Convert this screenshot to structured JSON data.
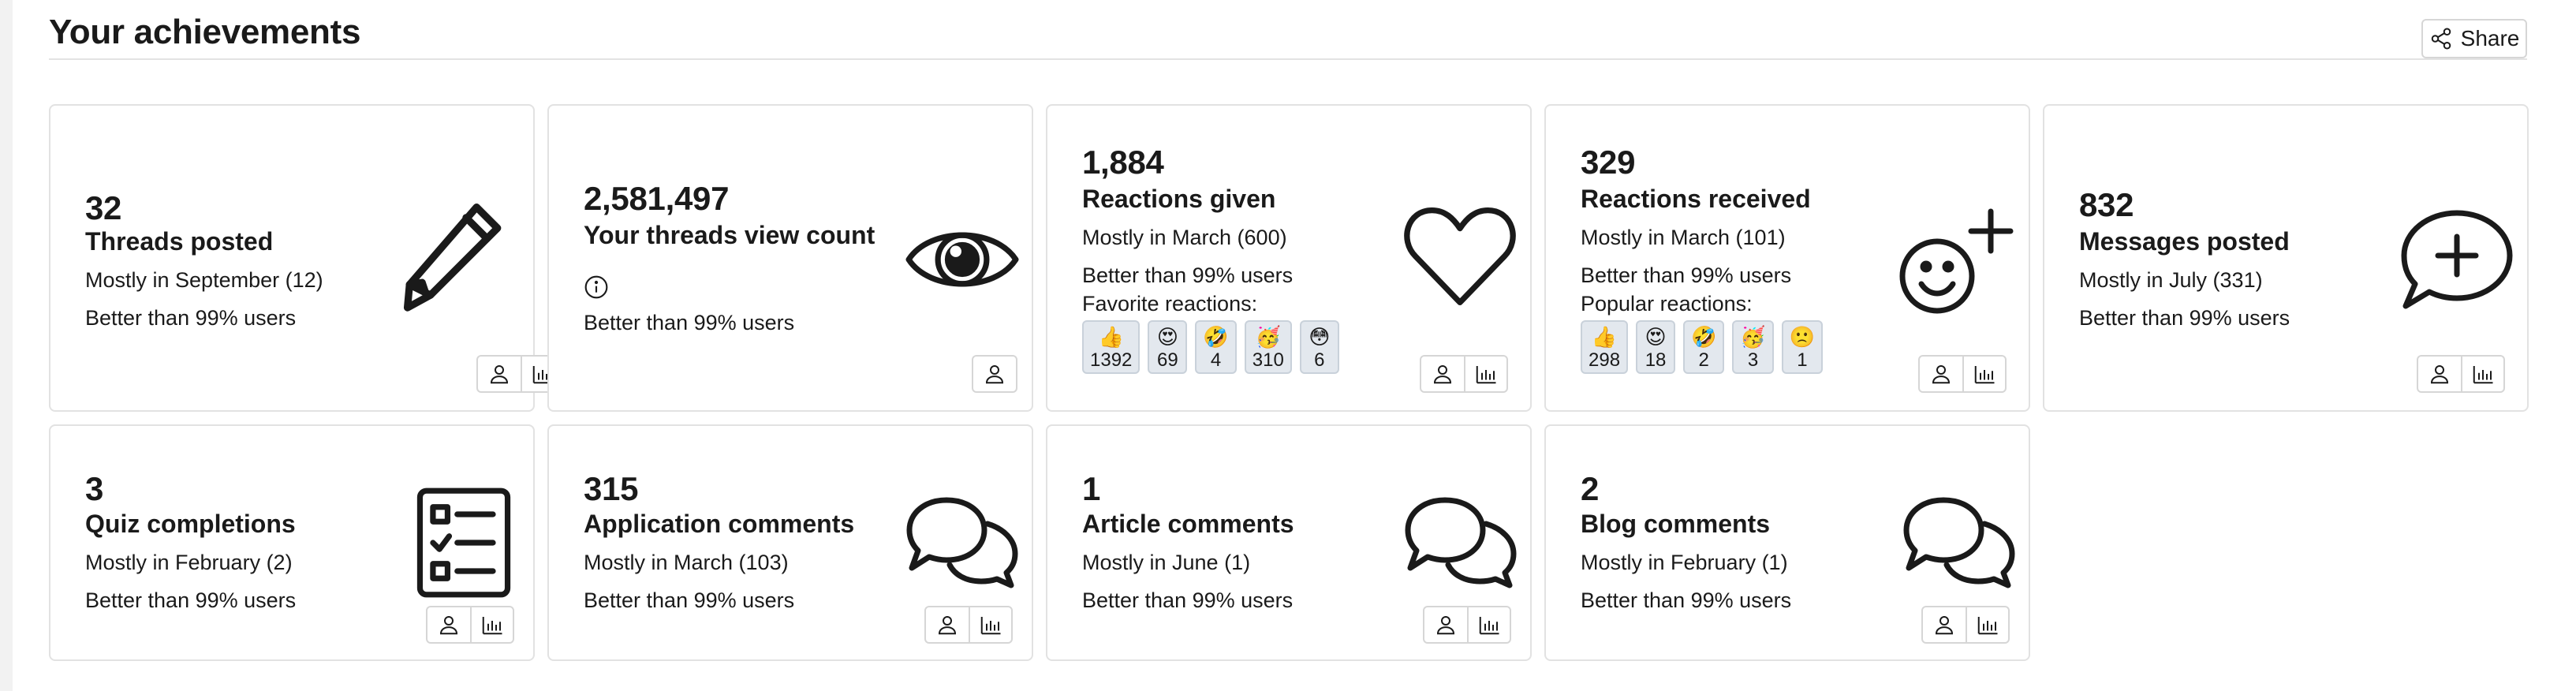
{
  "page": {
    "title": "Your achievements",
    "share_label": "Share"
  },
  "cards": {
    "threads": {
      "value": "32",
      "label": "Threads posted",
      "line1": "Mostly in September (12)",
      "line2": "Better than 99% users",
      "icon": "pencil-icon"
    },
    "views": {
      "value": "2,581,497",
      "label": "Your threads view count",
      "line2": "Better than 99% users",
      "icon": "eye-icon"
    },
    "reactions_given": {
      "value": "1,884",
      "label": "Reactions given",
      "line1": "Mostly in March (600)",
      "line2": "Better than 99% users",
      "fav_label": "Favorite reactions:",
      "reactions": [
        {
          "emoji": "👍",
          "count": "1392"
        },
        {
          "emoji": "😍",
          "count": "69"
        },
        {
          "emoji": "🤣",
          "count": "4"
        },
        {
          "emoji": "🥳",
          "count": "310"
        },
        {
          "emoji": "😳",
          "count": "6"
        }
      ],
      "icon": "heart-icon"
    },
    "reactions_received": {
      "value": "329",
      "label": "Reactions received",
      "line1": "Mostly in March (101)",
      "line2": "Better than 99% users",
      "fav_label": "Popular reactions:",
      "reactions": [
        {
          "emoji": "👍",
          "count": "298"
        },
        {
          "emoji": "😍",
          "count": "18"
        },
        {
          "emoji": "🤣",
          "count": "2"
        },
        {
          "emoji": "🥳",
          "count": "3"
        },
        {
          "emoji": "🙁",
          "count": "1"
        }
      ],
      "icon": "smiley-plus-icon"
    },
    "messages": {
      "value": "832",
      "label": "Messages posted",
      "line1": "Mostly in July (331)",
      "line2": "Better than 99% users",
      "icon": "chat-plus-icon"
    },
    "quiz": {
      "value": "3",
      "label": "Quiz completions",
      "line1": "Mostly in February (2)",
      "line2": "Better than 99% users",
      "icon": "checklist-icon"
    },
    "app_comments": {
      "value": "315",
      "label": "Application comments",
      "line1": "Mostly in March (103)",
      "line2": "Better than 99% users",
      "icon": "comments-icon"
    },
    "article_comments": {
      "value": "1",
      "label": "Article comments",
      "line1": "Mostly in June (1)",
      "line2": "Better than 99% users",
      "icon": "comments-icon"
    },
    "blog_comments": {
      "value": "2",
      "label": "Blog comments",
      "line1": "Mostly in February (1)",
      "line2": "Better than 99% users",
      "icon": "comments-icon"
    }
  }
}
